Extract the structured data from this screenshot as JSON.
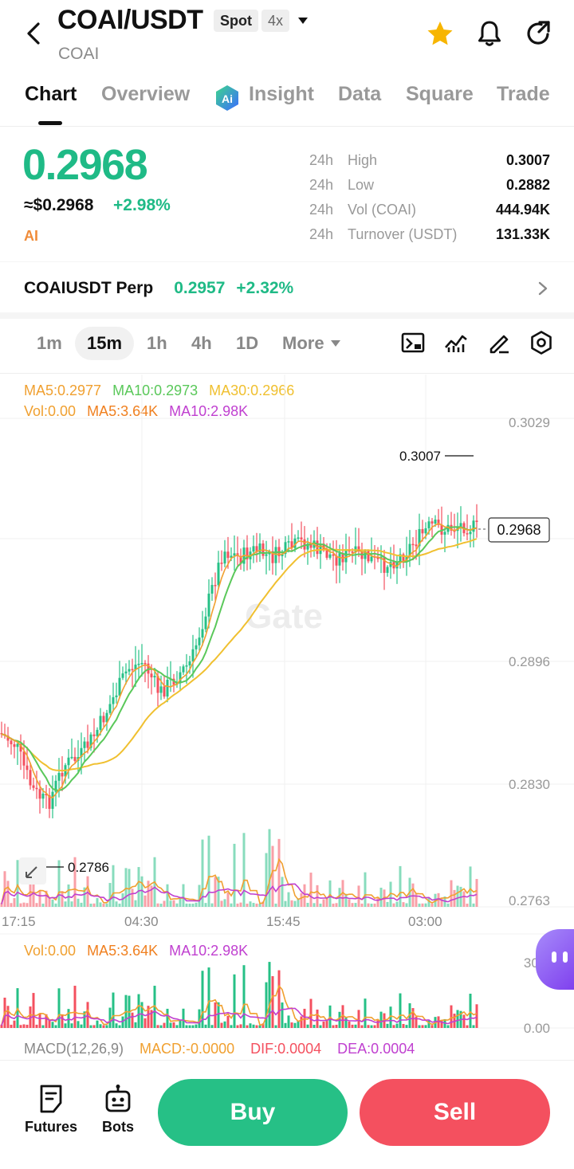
{
  "header": {
    "pair": "COAI/USDT",
    "market_badge": "Spot",
    "leverage_badge": "4x",
    "base_name": "COAI",
    "icons": [
      "back-arrow-icon",
      "chevron-down-icon",
      "star-icon",
      "bell-icon",
      "share-icon"
    ]
  },
  "tabs": [
    {
      "label": "Chart",
      "active": true
    },
    {
      "label": "Overview"
    },
    {
      "label": "Insight",
      "icon": "ai-icon"
    },
    {
      "label": "Data"
    },
    {
      "label": "Square"
    },
    {
      "label": "Trade"
    }
  ],
  "price": {
    "last": "0.2968",
    "usd": "≈$0.2968",
    "change": "+2.98%",
    "tag": "AI"
  },
  "stats": [
    {
      "period": "24h",
      "label": "High",
      "value": "0.3007"
    },
    {
      "period": "24h",
      "label": "Low",
      "value": "0.2882"
    },
    {
      "period": "24h",
      "label": "Vol (COAI)",
      "value": "444.94K"
    },
    {
      "period": "24h",
      "label": "Turnover (USDT)",
      "value": "131.33K"
    }
  ],
  "perp": {
    "name": "COAIUSDT Perp",
    "price": "0.2957",
    "change": "+2.32%"
  },
  "intervals": [
    {
      "label": "1m"
    },
    {
      "label": "15m",
      "selected": true
    },
    {
      "label": "1h"
    },
    {
      "label": "4h"
    },
    {
      "label": "1D"
    },
    {
      "label": "More"
    }
  ],
  "tools": [
    "chart-type-icon",
    "indicators-icon",
    "draw-icon",
    "settings-icon"
  ],
  "legends": {
    "ma5": "MA5:0.2977",
    "ma10": "MA10:0.2973",
    "ma30": "MA30:0.2966",
    "vol": "Vol:0.00",
    "vol_ma5": "MA5:3.64K",
    "vol_ma10": "MA10:2.98K",
    "macd_title": "MACD(12,26,9)",
    "macd": "MACD:-0.0000",
    "dif": "DIF:0.0004",
    "dea": "DEA:0.0004"
  },
  "colors": {
    "up": "#26c086",
    "down": "#f4505f",
    "ma5": "#f0a030",
    "ma10": "#5ac85a",
    "ma30": "#f0c030",
    "vol_ma10": "#c040d0"
  },
  "chart_data": {
    "type": "candlestick",
    "interval": "15m",
    "y_axis_ticks": [
      "0.3029",
      "0.2896",
      "0.2830",
      "0.2763"
    ],
    "x_axis_ticks": [
      "17:15",
      "04:30",
      "15:45",
      "03:00"
    ],
    "annotations": {
      "high_marker": "0.3007",
      "low_marker": "0.2786",
      "last_price_tag": "0.2968"
    },
    "watermark": "Gate",
    "volume_axis_ticks": [
      "30.9",
      "0.00"
    ],
    "ylim": [
      0.2763,
      0.3029
    ]
  },
  "bottom_bar": {
    "futures_label": "Futures",
    "bots_label": "Bots",
    "buy_label": "Buy",
    "sell_label": "Sell"
  }
}
